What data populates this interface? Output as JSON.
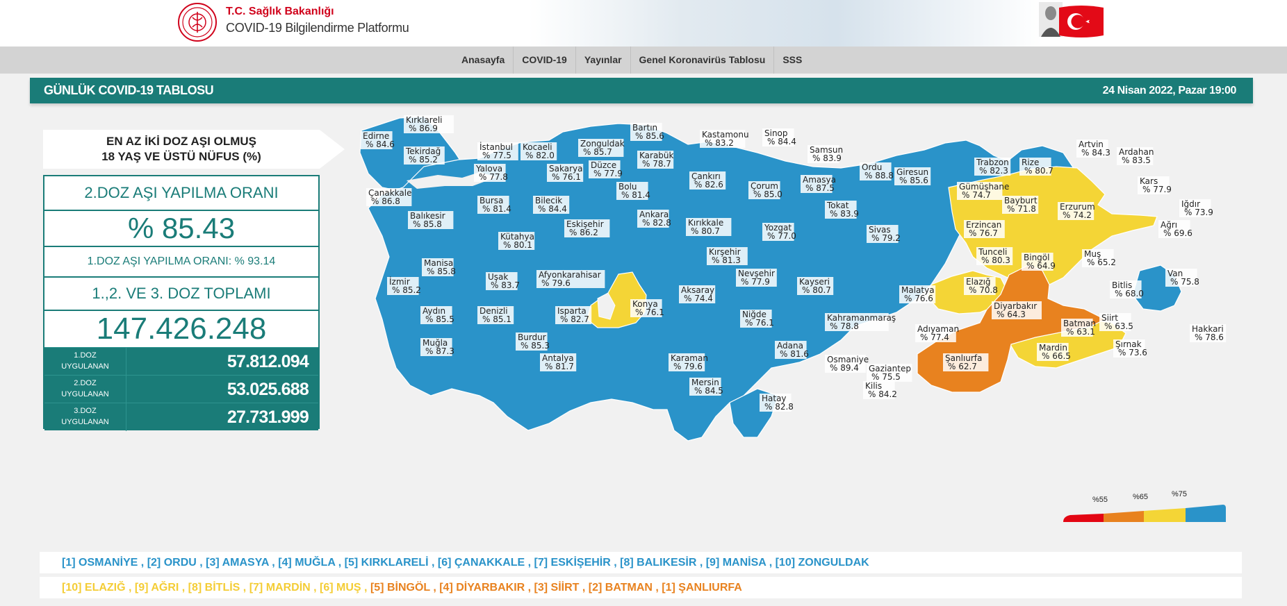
{
  "header": {
    "ministry": "T.C. Sağlık Bakanlığı",
    "platform": "COVID-19 Bilgilendirme Platformu"
  },
  "nav": {
    "items": [
      "Anasayfa",
      "COVID-19",
      "Yayınlar",
      "Genel Koronavirüs Tablosu",
      "SSS"
    ]
  },
  "title_bar": {
    "title": "GÜNLÜK COVID-19 TABLOSU",
    "date": "24 Nisan 2022, Pazar 19:00"
  },
  "stats": {
    "header_line1": "EN AZ İKİ DOZ AŞI OLMUŞ",
    "header_line2": "18 YAŞ VE ÜSTÜ NÜFUS (%)",
    "dose2_rate_label": "2.DOZ AŞI YAPILMA ORANI",
    "dose2_rate_value": "% 85.43",
    "dose1_rate_text": "1.DOZ AŞI YAPILMA ORANI: % 93.14",
    "total_label": "1.,2. VE 3. DOZ TOPLAMI",
    "total_value": "147.426.248",
    "doses": [
      {
        "label1": "1.DOZ",
        "label2": "UYGULANAN",
        "value": "57.812.094"
      },
      {
        "label1": "2.DOZ",
        "label2": "UYGULANAN",
        "value": "53.025.688"
      },
      {
        "label1": "3.DOZ",
        "label2": "UYGULANAN",
        "value": "27.731.999"
      }
    ]
  },
  "colors": {
    "blue": "#2a93c9",
    "yellow": "#f4d536",
    "orange": "#e8821f",
    "red": "#e30613",
    "teal": "#1a7c78"
  },
  "legend": {
    "ticks": [
      "%55",
      "%65",
      "%75"
    ]
  },
  "provinces": [
    {
      "name": "Kırklareli",
      "pct": "% 86.9"
    },
    {
      "name": "Edirne",
      "pct": "% 84.6"
    },
    {
      "name": "Tekirdağ",
      "pct": "% 85.2"
    },
    {
      "name": "İstanbul",
      "pct": "% 77.5"
    },
    {
      "name": "Kocaeli",
      "pct": "% 82.0"
    },
    {
      "name": "Zonguldak",
      "pct": "% 85.7"
    },
    {
      "name": "Bartın",
      "pct": "% 85.6"
    },
    {
      "name": "Kastamonu",
      "pct": "% 83.2"
    },
    {
      "name": "Sinop",
      "pct": "% 84.4"
    },
    {
      "name": "Samsun",
      "pct": "% 83.9"
    },
    {
      "name": "Ordu",
      "pct": "% 88.8"
    },
    {
      "name": "Giresun",
      "pct": "% 85.6"
    },
    {
      "name": "Trabzon",
      "pct": "% 82.3"
    },
    {
      "name": "Rize",
      "pct": "% 80.7"
    },
    {
      "name": "Artvin",
      "pct": "% 84.3"
    },
    {
      "name": "Ardahan",
      "pct": "% 83.5"
    },
    {
      "name": "Kars",
      "pct": "% 77.9"
    },
    {
      "name": "Iğdır",
      "pct": "% 73.9"
    },
    {
      "name": "Yalova",
      "pct": "% 77.8"
    },
    {
      "name": "Sakarya",
      "pct": "% 76.1"
    },
    {
      "name": "Düzce",
      "pct": "% 77.9"
    },
    {
      "name": "Karabük",
      "pct": "% 78.7"
    },
    {
      "name": "Bolu",
      "pct": "% 81.4"
    },
    {
      "name": "Çankırı",
      "pct": "% 82.6"
    },
    {
      "name": "Çorum",
      "pct": "% 85.0"
    },
    {
      "name": "Amasya",
      "pct": "% 87.5"
    },
    {
      "name": "Tokat",
      "pct": "% 83.9"
    },
    {
      "name": "Gümüşhane",
      "pct": "% 74.7"
    },
    {
      "name": "Bayburt",
      "pct": "% 71.8"
    },
    {
      "name": "Erzurum",
      "pct": "% 74.2"
    },
    {
      "name": "Ağrı",
      "pct": "% 69.6"
    },
    {
      "name": "Çanakkale",
      "pct": "% 86.8"
    },
    {
      "name": "Bursa",
      "pct": "% 81.4"
    },
    {
      "name": "Bilecik",
      "pct": "% 84.4"
    },
    {
      "name": "Balıkesir",
      "pct": "% 85.8"
    },
    {
      "name": "Eskişehir",
      "pct": "% 86.2"
    },
    {
      "name": "Ankara",
      "pct": "% 82.8"
    },
    {
      "name": "Kırıkkale",
      "pct": "% 80.7"
    },
    {
      "name": "Yozgat",
      "pct": "% 77.0"
    },
    {
      "name": "Sivas",
      "pct": "% 79.2"
    },
    {
      "name": "Erzincan",
      "pct": "% 76.7"
    },
    {
      "name": "Kütahya",
      "pct": "% 80.1"
    },
    {
      "name": "Kırşehir",
      "pct": "% 81.3"
    },
    {
      "name": "Tunceli",
      "pct": "% 80.3"
    },
    {
      "name": "Bingöl",
      "pct": "% 64.9"
    },
    {
      "name": "Muş",
      "pct": "% 65.2"
    },
    {
      "name": "Manisa",
      "pct": "% 85.8"
    },
    {
      "name": "Uşak",
      "pct": "% 83.7"
    },
    {
      "name": "Afyonkarahisar",
      "pct": "% 79.6"
    },
    {
      "name": "Nevşehir",
      "pct": "% 77.9"
    },
    {
      "name": "Kayseri",
      "pct": "% 80.7"
    },
    {
      "name": "Elazığ",
      "pct": "% 70.8"
    },
    {
      "name": "Bitlis",
      "pct": "% 68.0"
    },
    {
      "name": "Van",
      "pct": "% 75.8"
    },
    {
      "name": "İzmir",
      "pct": "% 85.2"
    },
    {
      "name": "Aksaray",
      "pct": "% 74.4"
    },
    {
      "name": "Malatya",
      "pct": "% 76.6"
    },
    {
      "name": "Diyarbakır",
      "pct": "% 64.3"
    },
    {
      "name": "Aydın",
      "pct": "% 85.5"
    },
    {
      "name": "Denizli",
      "pct": "% 85.1"
    },
    {
      "name": "Isparta",
      "pct": "% 82.7"
    },
    {
      "name": "Konya",
      "pct": "% 76.1"
    },
    {
      "name": "Niğde",
      "pct": "% 76.1"
    },
    {
      "name": "Kahramanmaraş",
      "pct": "% 78.8"
    },
    {
      "name": "Adıyaman",
      "pct": "% 77.4"
    },
    {
      "name": "Batman",
      "pct": "% 63.1"
    },
    {
      "name": "Siirt",
      "pct": "% 63.5"
    },
    {
      "name": "Hakkari",
      "pct": "% 78.6"
    },
    {
      "name": "Burdur",
      "pct": "% 85.3"
    },
    {
      "name": "Muğla",
      "pct": "% 87.3"
    },
    {
      "name": "Antalya",
      "pct": "% 81.7"
    },
    {
      "name": "Karaman",
      "pct": "% 79.6"
    },
    {
      "name": "Adana",
      "pct": "% 81.6"
    },
    {
      "name": "Osmaniye",
      "pct": "% 89.4"
    },
    {
      "name": "Gaziantep",
      "pct": "% 75.5"
    },
    {
      "name": "Şanlıurfa",
      "pct": "% 62.7"
    },
    {
      "name": "Mardin",
      "pct": "% 66.5"
    },
    {
      "name": "Şırnak",
      "pct": "% 73.6"
    },
    {
      "name": "Mersin",
      "pct": "% 84.5"
    },
    {
      "name": "Hatay",
      "pct": "% 82.8"
    },
    {
      "name": "Kilis",
      "pct": "% 84.2"
    }
  ],
  "best_list": [
    {
      "rank": "[1]",
      "name": "OSMANİYE"
    },
    {
      "rank": "[2]",
      "name": "ORDU"
    },
    {
      "rank": "[3]",
      "name": "AMASYA"
    },
    {
      "rank": "[4]",
      "name": "MUĞLA"
    },
    {
      "rank": "[5]",
      "name": "KIRKLARELİ"
    },
    {
      "rank": "[6]",
      "name": "ÇANAKKALE"
    },
    {
      "rank": "[7]",
      "name": "ESKİŞEHİR"
    },
    {
      "rank": "[8]",
      "name": "BALIKESİR"
    },
    {
      "rank": "[9]",
      "name": "MANİSA"
    },
    {
      "rank": "[10]",
      "name": "ZONGULDAK"
    }
  ],
  "worst_list": [
    {
      "rank": "[10]",
      "name": "ELAZIĞ",
      "tone": "yellow"
    },
    {
      "rank": "[9]",
      "name": "AĞRI",
      "tone": "yellow"
    },
    {
      "rank": "[8]",
      "name": "BİTLİS",
      "tone": "yellow"
    },
    {
      "rank": "[7]",
      "name": "MARDİN",
      "tone": "yellow"
    },
    {
      "rank": "[6]",
      "name": "MUŞ",
      "tone": "yellow"
    },
    {
      "rank": "[5]",
      "name": "BİNGÖL",
      "tone": "orange"
    },
    {
      "rank": "[4]",
      "name": "DİYARBAKIR",
      "tone": "orange"
    },
    {
      "rank": "[3]",
      "name": "SİİRT",
      "tone": "orange"
    },
    {
      "rank": "[2]",
      "name": "BATMAN",
      "tone": "orange"
    },
    {
      "rank": "[1]",
      "name": "ŞANLIURFA",
      "tone": "orange"
    }
  ]
}
